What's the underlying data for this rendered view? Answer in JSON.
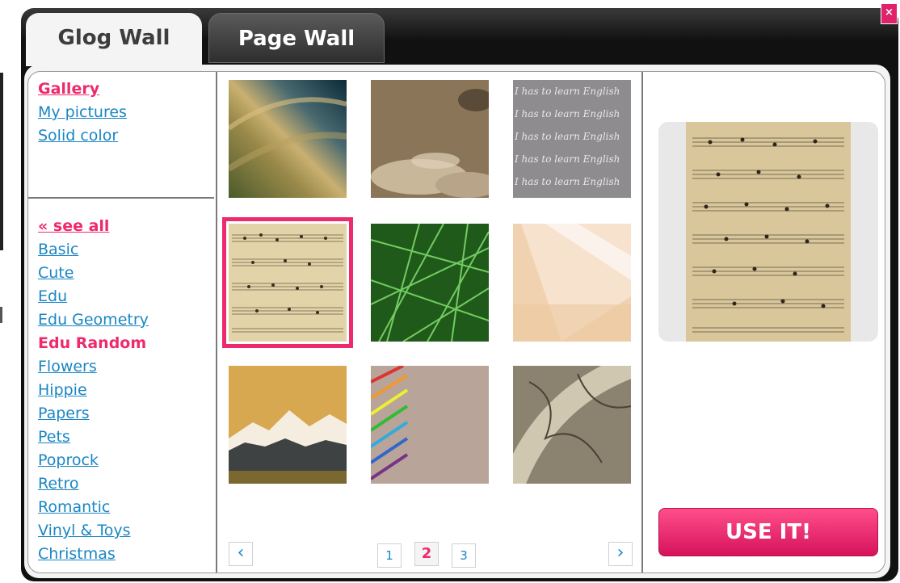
{
  "window": {
    "close_label": "×"
  },
  "tabs": [
    {
      "label": "Glog Wall",
      "active": true
    },
    {
      "label": "Page Wall",
      "active": false
    }
  ],
  "sources": [
    {
      "label": "Gallery",
      "active": true
    },
    {
      "label": "My pictures",
      "active": false
    },
    {
      "label": "Solid color",
      "active": false
    }
  ],
  "categories": {
    "see_all": "« see all",
    "items": [
      {
        "label": "Basic",
        "active": false
      },
      {
        "label": "Cute",
        "active": false
      },
      {
        "label": "Edu",
        "active": false
      },
      {
        "label": "Edu Geometry",
        "active": false
      },
      {
        "label": "Edu Random",
        "active": true
      },
      {
        "label": "Flowers",
        "active": false
      },
      {
        "label": "Hippie",
        "active": false
      },
      {
        "label": "Papers",
        "active": false
      },
      {
        "label": "Pets",
        "active": false
      },
      {
        "label": "Poprock",
        "active": false
      },
      {
        "label": "Retro",
        "active": false
      },
      {
        "label": "Romantic",
        "active": false
      },
      {
        "label": "Vinyl & Toys",
        "active": false
      },
      {
        "label": "Christmas",
        "active": false
      }
    ]
  },
  "gallery": {
    "thumbnails": [
      {
        "name": "space-horizon"
      },
      {
        "name": "sepia-clouds"
      },
      {
        "name": "handwriting-lines",
        "text": "I has to learn English"
      },
      {
        "name": "sheet-music",
        "selected": true
      },
      {
        "name": "green-grass"
      },
      {
        "name": "peach-light"
      },
      {
        "name": "mountain-forest"
      },
      {
        "name": "colored-pencils"
      },
      {
        "name": "old-map"
      }
    ],
    "pagination": {
      "prev": "‹",
      "next": "›",
      "pages": [
        "1",
        "2",
        "3"
      ],
      "current": "2"
    }
  },
  "preview": {
    "name": "sheet-music"
  },
  "actions": {
    "use_label": "USE IT!"
  },
  "colors": {
    "accent": "#ee2a6e",
    "link": "#1a86c5",
    "window": "#111111"
  }
}
